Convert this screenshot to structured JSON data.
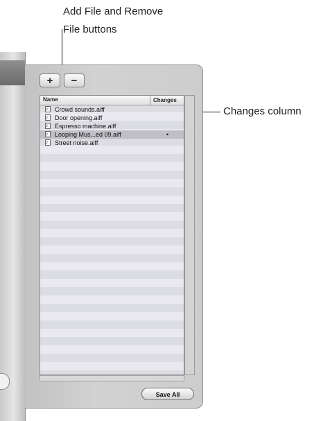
{
  "callouts": {
    "buttons_line1": "Add File and Remove",
    "buttons_line2": "File buttons",
    "changes_column": "Changes column"
  },
  "toolbar": {
    "add_label": "+",
    "remove_label": "−"
  },
  "file_list": {
    "columns": [
      "Name",
      "Changes"
    ],
    "rows": [
      {
        "name": "Crowd sounds.aiff",
        "changes": ""
      },
      {
        "name": "Door opening.aiff",
        "changes": ""
      },
      {
        "name": "Espresso machine.aiff",
        "changes": ""
      },
      {
        "name": "Looping Mus...ed 09.aiff",
        "changes": "•",
        "selected": true
      },
      {
        "name": "Street noise.aiff",
        "changes": ""
      }
    ]
  },
  "footer": {
    "save_all_label": "Save All"
  },
  "icons": {
    "file_icon": "audio-file-icon",
    "grip": "resize-grip-icon"
  }
}
